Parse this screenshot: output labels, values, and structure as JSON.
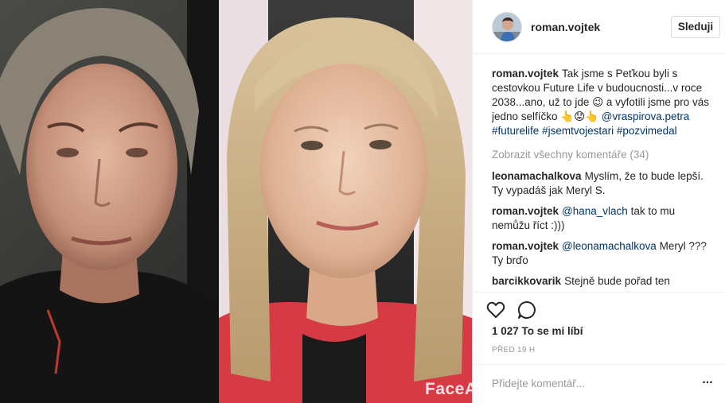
{
  "post": {
    "author": "roman.vojtek",
    "follow_label": "Sleduji",
    "caption": {
      "user": "roman.vojtek",
      "text": "Tak jsme s Peťkou byli s cestovkou Future Life v budoucnosti...v roce 2038...ano, už to jde 😉 a vyfotili jsme pro vás jedno selfíčko 👆😟👆",
      "mention": "@vraspirova.petra",
      "hashtags": [
        "#futurelife",
        "#jsemtvojestari",
        "#pozvimedal"
      ]
    },
    "load_more_label": "Zobrazit všechny komentáře (34)",
    "comments": [
      {
        "user": "leonamachalkova",
        "mention": "",
        "text": "Myslím, že to bude lepší. Ty vypadáš jak Meryl S."
      },
      {
        "user": "roman.vojtek",
        "mention": "@hana_vlach",
        "text": "tak to mu nemůžu říct :)))"
      },
      {
        "user": "roman.vojtek",
        "mention": "@leonamachalkova",
        "text": "Meryl ??? Ty brďo"
      },
      {
        "user": "barcikkovarik",
        "mention": "",
        "text": "Stejně bude pořad ten"
      }
    ],
    "likes_label": "1 027 To se mi líbí",
    "time_label": "PŘED 19 H",
    "add_comment_placeholder": "Přidejte komentář...",
    "more_options_label": "...",
    "photo": {
      "watermark": "FaceApp",
      "icon": "photo-selfie"
    },
    "icons": {
      "like": "heart-icon",
      "comment": "speech-bubble-icon",
      "more": "more-options-icon"
    },
    "colors": {
      "link": "#003569",
      "muted": "#999999",
      "text": "#262626",
      "border": "#efefef"
    }
  }
}
